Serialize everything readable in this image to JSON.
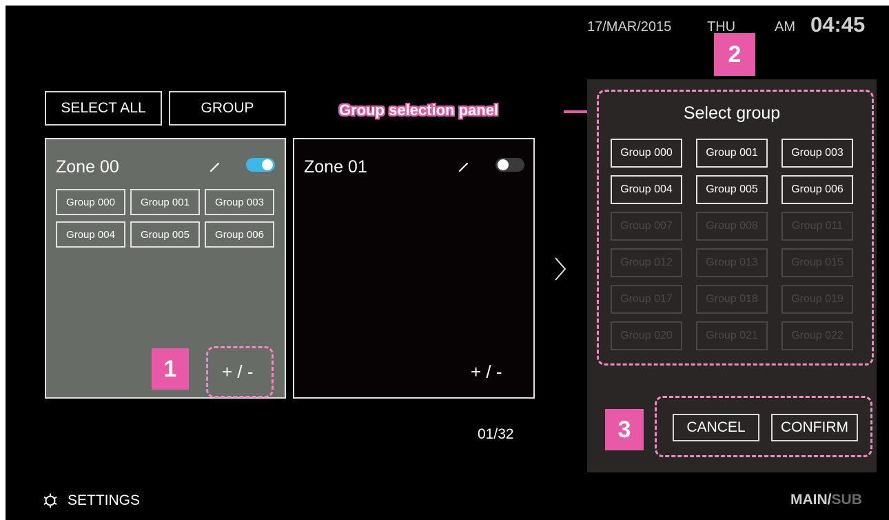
{
  "header": {
    "date": "17/MAR/2015",
    "day": "THU",
    "ampm": "AM",
    "time": "04:45"
  },
  "toolbar": {
    "select_all": "SELECT ALL",
    "group": "GROUP"
  },
  "callouts": {
    "panel_label": "Group selection panel",
    "badge_1": "1",
    "badge_2": "2",
    "badge_3": "3"
  },
  "zones": [
    {
      "title": "Zone 00",
      "enabled": true,
      "groups": [
        "Group 000",
        "Group 001",
        "Group 003",
        "Group 004",
        "Group 005",
        "Group 006"
      ],
      "add_remove": "+ / -"
    },
    {
      "title": "Zone 01",
      "enabled": false,
      "groups": [],
      "add_remove": "+ / -"
    }
  ],
  "pagination": {
    "counter": "01/32"
  },
  "group_panel": {
    "title": "Select group",
    "groups": [
      {
        "label": "Group 000",
        "enabled": true
      },
      {
        "label": "Group 001",
        "enabled": true
      },
      {
        "label": "Group 003",
        "enabled": true
      },
      {
        "label": "Group 004",
        "enabled": true
      },
      {
        "label": "Group 005",
        "enabled": true
      },
      {
        "label": "Group 006",
        "enabled": true
      },
      {
        "label": "Group 007",
        "enabled": false
      },
      {
        "label": "Group 008",
        "enabled": false
      },
      {
        "label": "Group 011",
        "enabled": false
      },
      {
        "label": "Group 012",
        "enabled": false
      },
      {
        "label": "Group 013",
        "enabled": false
      },
      {
        "label": "Group 015",
        "enabled": false
      },
      {
        "label": "Group 017",
        "enabled": false
      },
      {
        "label": "Group 018",
        "enabled": false
      },
      {
        "label": "Group 019",
        "enabled": false
      },
      {
        "label": "Group 020",
        "enabled": false
      },
      {
        "label": "Group 021",
        "enabled": false
      },
      {
        "label": "Group 022",
        "enabled": false
      }
    ],
    "cancel": "CANCEL",
    "confirm": "CONFIRM"
  },
  "footer": {
    "settings": "SETTINGS",
    "main": "MAIN",
    "separator": "/",
    "sub": "SUB"
  },
  "colors": {
    "accent_pink": "#e85aa7",
    "toggle_on": "#3bb8ea",
    "zone_selected_bg": "#676c67",
    "panel_bg": "#2a2626"
  }
}
